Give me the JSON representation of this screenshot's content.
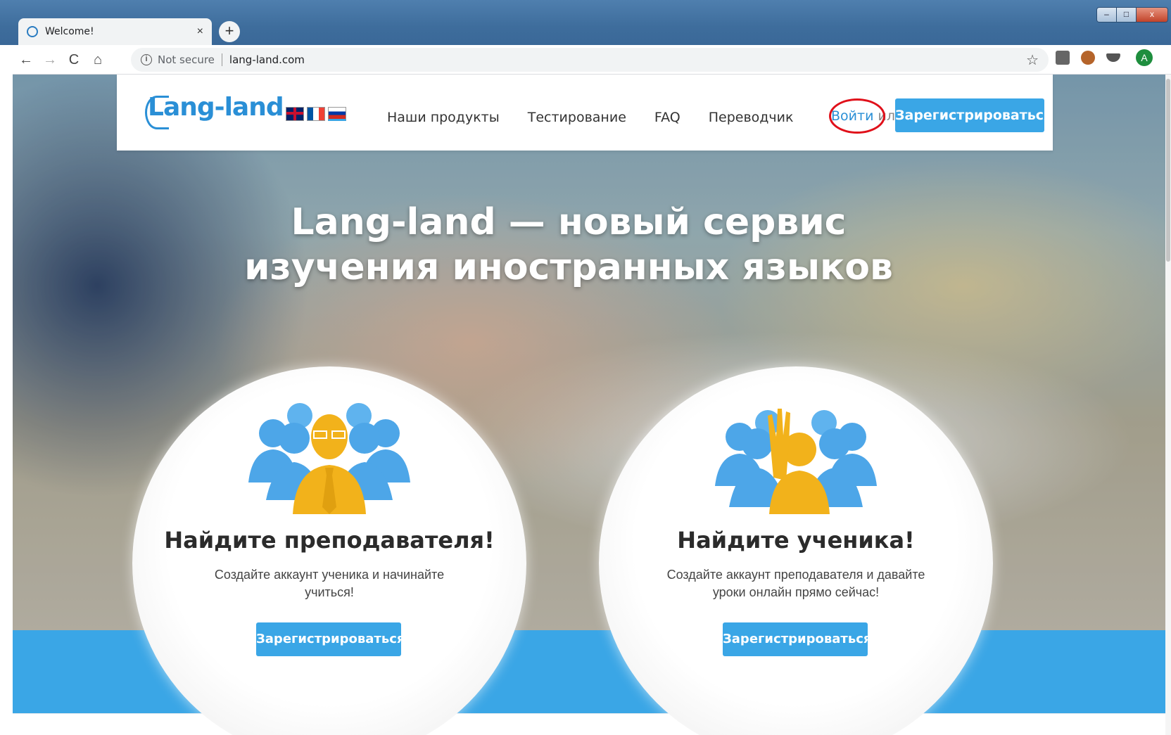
{
  "browser": {
    "tab_title": "Welcome!",
    "tab_close": "×",
    "new_tab": "+",
    "security_label": "Not secure",
    "url": "lang-land.com",
    "profile_initial": "A",
    "window_controls": {
      "minimize": "–",
      "maximize": "□",
      "close": "x"
    }
  },
  "site": {
    "logo_text": "Lang-land",
    "languages": [
      "en",
      "fr",
      "ru"
    ],
    "nav": [
      "Наши продукты",
      "Тестирование",
      "FAQ",
      "Переводчик"
    ],
    "login_label": "Войти",
    "login_or": " или",
    "register_label": "Зарегистрироваться"
  },
  "hero": {
    "headline_line1": "Lang-land — новый сервис",
    "headline_line2": "изучения иностранных языков"
  },
  "cards": [
    {
      "title": "Найдите преподавателя!",
      "text": "Создайте аккаунт ученика и начинайте учиться!",
      "button": "Зарегистрироваться"
    },
    {
      "title": "Найдите ученика!",
      "text": "Создайте аккаунт преподавателя и давайте уроки онлайн прямо сейчас!",
      "button": "Зарегистрироваться"
    }
  ],
  "colors": {
    "brand_blue": "#3aa6e6",
    "logo_blue": "#2a8fd6",
    "annotation_red": "#e0101a",
    "figure_blue": "#4da6e8",
    "figure_yellow": "#f2b21b"
  }
}
